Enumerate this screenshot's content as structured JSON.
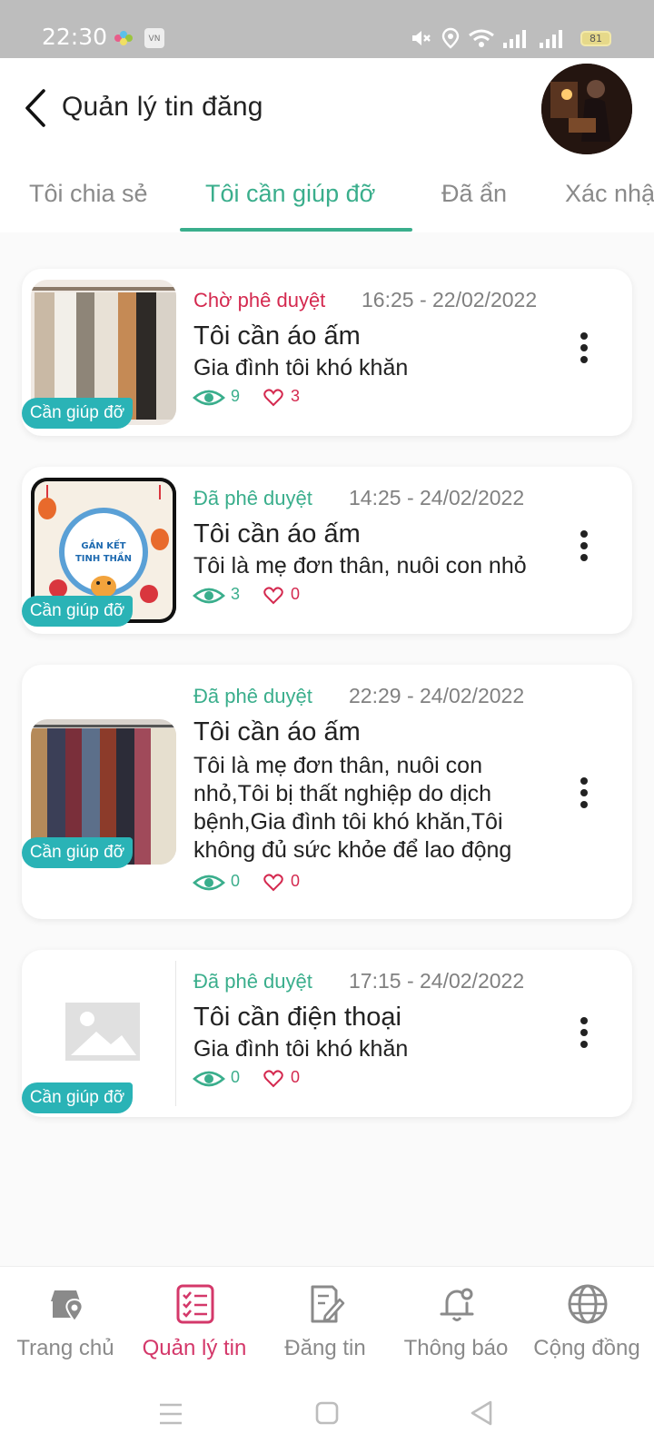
{
  "status_bar": {
    "time": "22:30",
    "battery": "81"
  },
  "header": {
    "title": "Quản lý tin đăng"
  },
  "tabs": [
    {
      "label": "Tôi chia sẻ",
      "active": false
    },
    {
      "label": "Tôi cần giúp đỡ",
      "active": true
    },
    {
      "label": "Đã ẩn",
      "active": false
    },
    {
      "label": "Xác nhậ",
      "active": false
    }
  ],
  "posts": [
    {
      "badge": "Cần giúp đỡ",
      "status": "Chờ phê duyệt",
      "status_color": "#d4294f",
      "datetime": "16:25 - 22/02/2022",
      "title": "Tôi cần áo ấm",
      "description": "Gia đình tôi khó khăn",
      "views": "9",
      "likes": "3",
      "image": "clothes-rack-photo"
    },
    {
      "badge": "Cần giúp đỡ",
      "status": "Đã phê duyệt",
      "status_color": "#3aae8c",
      "datetime": "14:25 - 24/02/2022",
      "title": "Tôi cần áo ấm",
      "description": "Tôi là mẹ đơn thân, nuôi con nhỏ",
      "views": "3",
      "likes": "0",
      "image": "lunar-new-year-poster",
      "poster_text": "GẮN KẾT TINH THẦN"
    },
    {
      "badge": "Cần giúp đỡ",
      "status": "Đã phê duyệt",
      "status_color": "#3aae8c",
      "datetime": "22:29 - 24/02/2022",
      "title": "Tôi cần áo ấm",
      "description": "Tôi là mẹ đơn thân, nuôi con nhỏ,Tôi bị thất nghiệp do dịch bệnh,Gia đình tôi khó khăn,Tôi không đủ sức khỏe để lao động",
      "views": "0",
      "likes": "0",
      "image": "hanging-coats-photo"
    },
    {
      "badge": "Cần giúp đỡ",
      "status": "Đã phê duyệt",
      "status_color": "#3aae8c",
      "datetime": "17:15 - 24/02/2022",
      "title": "Tôi cần điện thoại",
      "description": "Gia đình tôi khó khăn",
      "views": "0",
      "likes": "0",
      "image": "image-placeholder-icon"
    }
  ],
  "bottom_nav": [
    {
      "label": "Trang chủ",
      "icon": "home-location-icon",
      "active": false
    },
    {
      "label": "Quản lý tin",
      "icon": "checklist-icon",
      "active": true
    },
    {
      "label": "Đăng tin",
      "icon": "edit-document-icon",
      "active": false
    },
    {
      "label": "Thông báo",
      "icon": "bell-icon",
      "active": false
    },
    {
      "label": "Cộng đồng",
      "icon": "globe-icon",
      "active": false
    }
  ],
  "colors": {
    "primary": "#3aae8c",
    "accent": "#d4386a",
    "badge": "#2ab3b6"
  }
}
